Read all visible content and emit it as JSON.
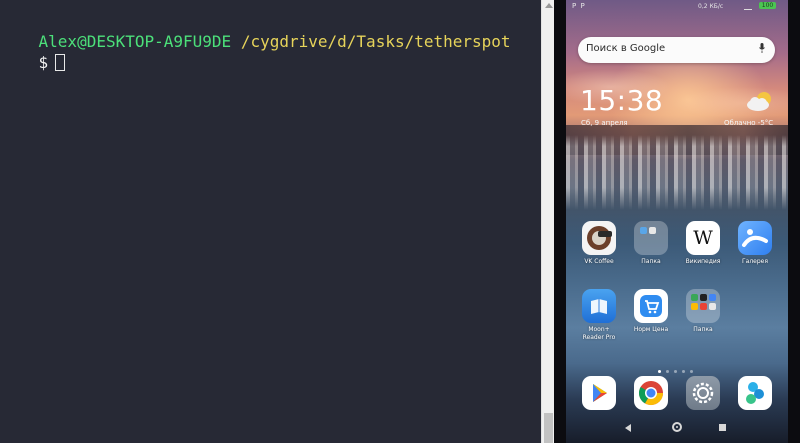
{
  "terminal": {
    "user_host": "Alex@DESKTOP-A9FU9DE",
    "path": "/cygdrive/d/Tasks/tetherspot",
    "prompt_symbol": "$"
  },
  "phone": {
    "status": {
      "left": "P P",
      "speed": "0,2 КБ/с",
      "battery": "100"
    },
    "search_placeholder": "Поиск в Google",
    "clock": "15:38",
    "date": "Сб, 9 апреля",
    "weather": "Облачно  -5°C",
    "apps_row1": [
      {
        "label": "VK Coffee",
        "icon": "vk-coffee-icon"
      },
      {
        "label": "Папка",
        "icon": "folder-icon"
      },
      {
        "label": "Википедия",
        "icon": "wikipedia-icon"
      },
      {
        "label": "Галерея",
        "icon": "gallery-icon"
      }
    ],
    "apps_row2": [
      {
        "label": "Moon+ Reader Pro",
        "label_line1": "Moon+",
        "label_line2": "Reader Pro",
        "icon": "moon-reader-icon"
      },
      {
        "label": "Норм Цена",
        "icon": "shopping-cart-icon"
      },
      {
        "label": "Папка",
        "icon": "folder-icon"
      }
    ],
    "dock": [
      {
        "icon": "play-store-icon"
      },
      {
        "icon": "chrome-icon"
      },
      {
        "icon": "settings-icon"
      },
      {
        "icon": "app-icon"
      }
    ],
    "wikipedia_glyph": "W",
    "page_count": 5,
    "active_page": 1
  },
  "colors": {
    "terminal_bg": "#272935",
    "user_host": "#4ce07a",
    "path": "#e6d35a",
    "battery": "#4cc452"
  }
}
